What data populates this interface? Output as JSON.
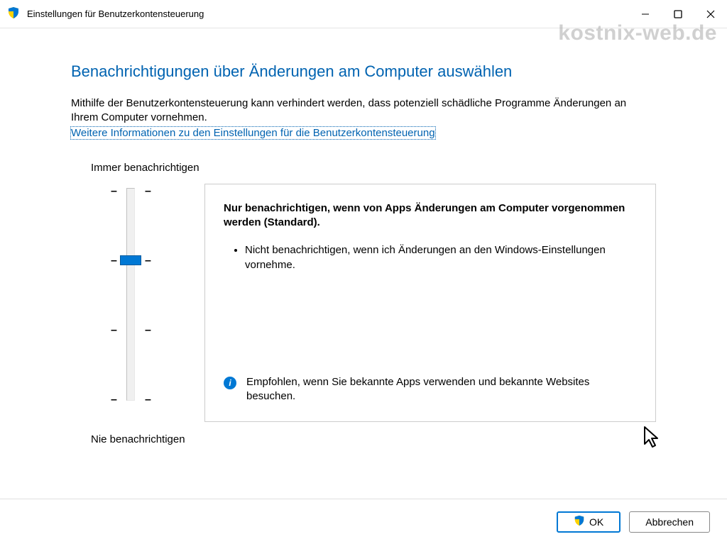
{
  "window": {
    "title": "Einstellungen für Benutzerkontensteuerung"
  },
  "main": {
    "heading": "Benachrichtigungen über Änderungen am Computer auswählen",
    "description": "Mithilfe der Benutzerkontensteuerung kann verhindert werden, dass potenziell schädliche Programme Änderungen an Ihrem Computer vornehmen.",
    "help_link": "Weitere Informationen zu den Einstellungen für die Benutzerkontensteuerung"
  },
  "slider": {
    "top_label": "Immer benachrichtigen",
    "bottom_label": "Nie benachrichtigen",
    "level": 2,
    "panel": {
      "title": "Nur benachrichtigen, wenn von Apps Änderungen am Computer vorgenommen werden (Standard).",
      "bullet1": "Nicht benachrichtigen, wenn ich Änderungen an den Windows-Einstellungen vornehme.",
      "recommendation": "Empfohlen, wenn Sie bekannte Apps verwenden und bekannte Websites besuchen."
    }
  },
  "footer": {
    "ok": "OK",
    "cancel": "Abbrechen"
  },
  "watermark": "kostnix-web.de"
}
